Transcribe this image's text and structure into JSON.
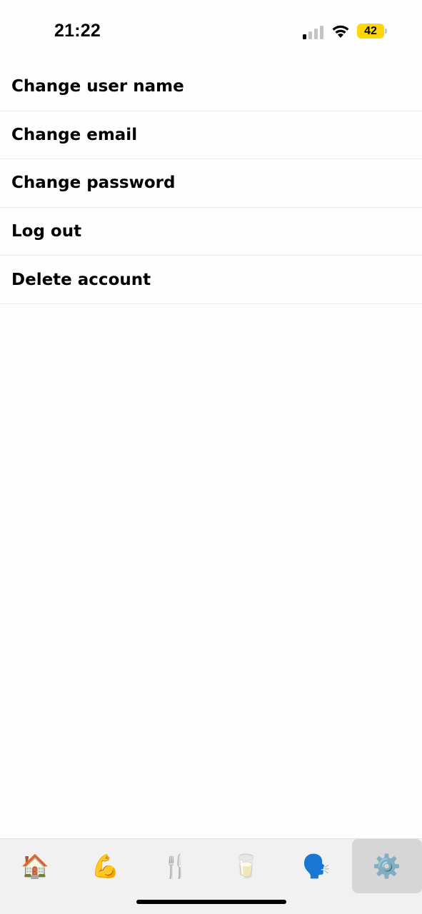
{
  "status_bar": {
    "time": "21:22",
    "battery_level": "42",
    "signal_bars_active": 1,
    "signal_bars_total": 4
  },
  "settings": {
    "items": [
      {
        "label": "Change user name"
      },
      {
        "label": "Change email"
      },
      {
        "label": "Change password"
      },
      {
        "label": "Log out"
      },
      {
        "label": "Delete account"
      }
    ]
  },
  "tab_bar": {
    "tabs": [
      {
        "icon": "🏠",
        "icon_name": "house-icon"
      },
      {
        "icon": "💪",
        "icon_name": "flexed-biceps-icon"
      },
      {
        "icon": "🍴",
        "icon_name": "fork-and-knife-icon"
      },
      {
        "icon": "🥛",
        "icon_name": "glass-of-milk-icon"
      },
      {
        "icon": "🗣️",
        "icon_name": "speaking-head-icon"
      },
      {
        "icon": "⚙️",
        "icon_name": "gear-icon"
      }
    ],
    "active_index": 5
  },
  "colors": {
    "battery": "#ffd60a",
    "tab_bar_bg": "#f1f1f1",
    "active_tab_bg": "#d6d6d6"
  }
}
